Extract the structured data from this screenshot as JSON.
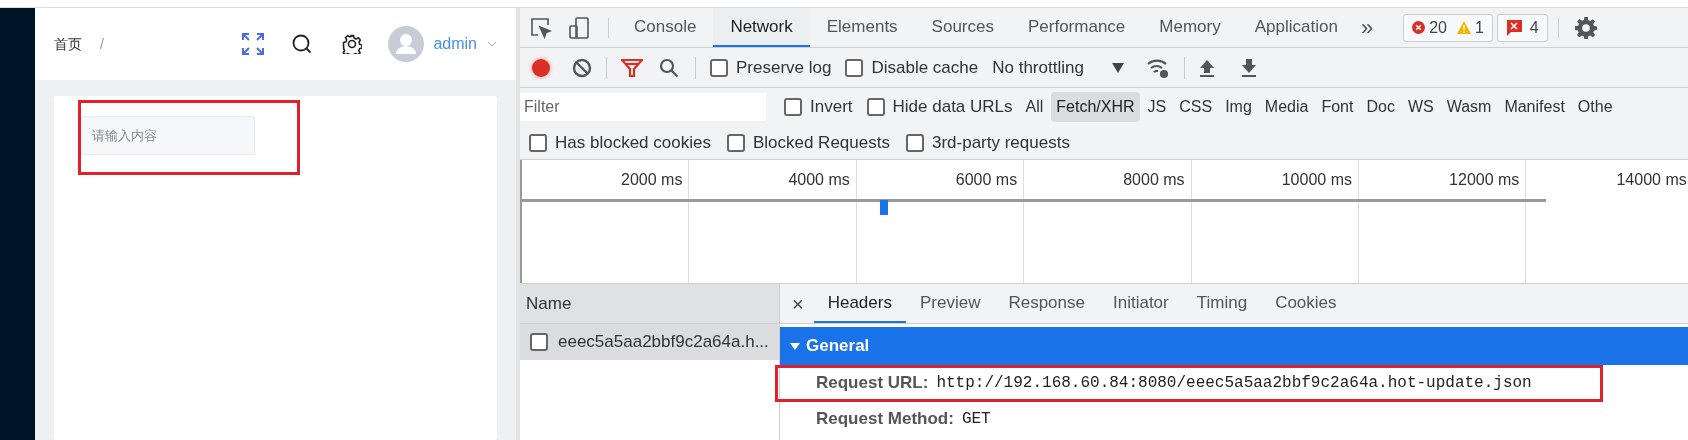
{
  "app": {
    "breadcrumb": [
      {
        "label": "首页"
      },
      {
        "label": "/"
      }
    ],
    "user": "admin",
    "input": {
      "placeholder": "请输入内容"
    }
  },
  "devtools": {
    "tabs": [
      {
        "label": "Console",
        "selected": false
      },
      {
        "label": "Network",
        "selected": true
      },
      {
        "label": "Elements",
        "selected": false
      },
      {
        "label": "Sources",
        "selected": false
      },
      {
        "label": "Performance",
        "selected": false
      },
      {
        "label": "Memory",
        "selected": false
      },
      {
        "label": "Application",
        "selected": false
      }
    ],
    "more_tabs": "»",
    "error_count": "20",
    "warning_count": "1",
    "issue_count": "4",
    "toolbar": {
      "recording": true,
      "options": [
        {
          "label": "Preserve log",
          "checked": false
        },
        {
          "label": "Disable cache",
          "checked": false
        }
      ],
      "throttling": "No throttling"
    },
    "filter": {
      "placeholder": "Filter",
      "options": [
        {
          "label": "Invert",
          "checked": false
        },
        {
          "label": "Hide data URLs",
          "checked": false
        }
      ],
      "types": [
        {
          "label": "All",
          "selected": false
        },
        {
          "label": "Fetch/XHR",
          "selected": true
        },
        {
          "label": "JS",
          "selected": false
        },
        {
          "label": "CSS",
          "selected": false
        },
        {
          "label": "Img",
          "selected": false
        },
        {
          "label": "Media",
          "selected": false
        },
        {
          "label": "Font",
          "selected": false
        },
        {
          "label": "Doc",
          "selected": false
        },
        {
          "label": "WS",
          "selected": false
        },
        {
          "label": "Wasm",
          "selected": false
        },
        {
          "label": "Manifest",
          "selected": false
        },
        {
          "label": "Othe",
          "selected": false
        }
      ]
    },
    "blocked_options": [
      {
        "label": "Has blocked cookies",
        "checked": false
      },
      {
        "label": "Blocked Requests",
        "checked": false
      },
      {
        "label": "3rd-party requests",
        "checked": false
      }
    ],
    "timeline": {
      "ticks": [
        "2000 ms",
        "4000 ms",
        "6000 ms",
        "8000 ms",
        "10000 ms",
        "12000 ms",
        "14000 ms"
      ]
    },
    "requests": {
      "column": "Name",
      "rows": [
        {
          "name": "eeec5a5aa2bbf9c2a64a.h...",
          "selected": true,
          "checked": false
        }
      ]
    },
    "details": {
      "close": "×",
      "tabs": [
        {
          "label": "Headers",
          "selected": true
        },
        {
          "label": "Preview",
          "selected": false
        },
        {
          "label": "Response",
          "selected": false
        },
        {
          "label": "Initiator",
          "selected": false
        },
        {
          "label": "Timing",
          "selected": false
        },
        {
          "label": "Cookies",
          "selected": false
        }
      ],
      "section": {
        "title": "General",
        "expanded": true,
        "fields": [
          {
            "label": "Request URL:",
            "value": "http://192.168.60.84:8080/eeec5a5aa2bbf9c2a64a.hot-update.json"
          },
          {
            "label": "Request Method:",
            "value": "GET"
          }
        ]
      }
    }
  }
}
